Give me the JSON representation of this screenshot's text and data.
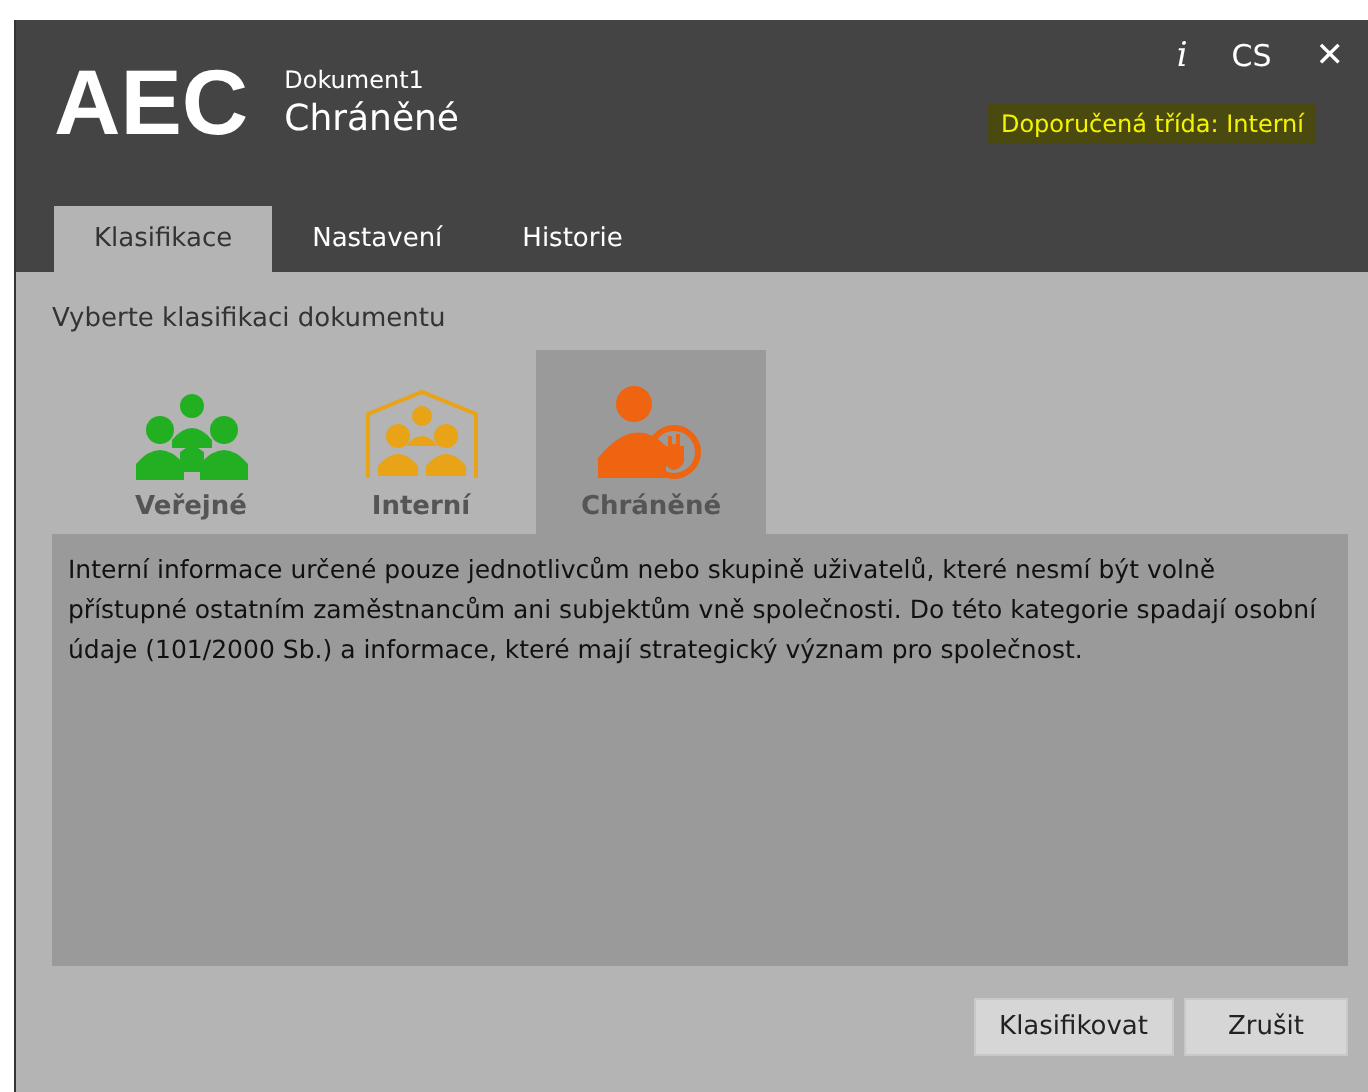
{
  "header": {
    "logo": "AEC",
    "document": "Dokument1",
    "classification": "Chráněné",
    "info": "i",
    "language": "CS",
    "close": "✕",
    "recommended": "Doporučená třída:  Interní"
  },
  "tabs": [
    {
      "label": "Klasifikace",
      "selected": true
    },
    {
      "label": "Nastavení",
      "selected": false
    },
    {
      "label": "Historie",
      "selected": false
    }
  ],
  "prompt": "Vyberte klasifikaci dokumentu",
  "classes": [
    {
      "label": "Veřejné",
      "kind": "public",
      "color": "#22b022",
      "selected": false
    },
    {
      "label": "Interní",
      "kind": "internal",
      "color": "#e8a317",
      "selected": false
    },
    {
      "label": "Chráněné",
      "kind": "protected",
      "color": "#ee6410",
      "selected": true
    }
  ],
  "description": "Interní informace určené pouze jednotlivcům nebo skupině uživatelů, které nesmí být volně přístupné ostatním zaměstnancům ani subjektům vně společnosti. Do této kategorie spadají osobní údaje (101/2000 Sb.) a informace, které mají strategický význam pro společnost.",
  "buttons": [
    "Klasifikovat",
    "Zrušit"
  ]
}
